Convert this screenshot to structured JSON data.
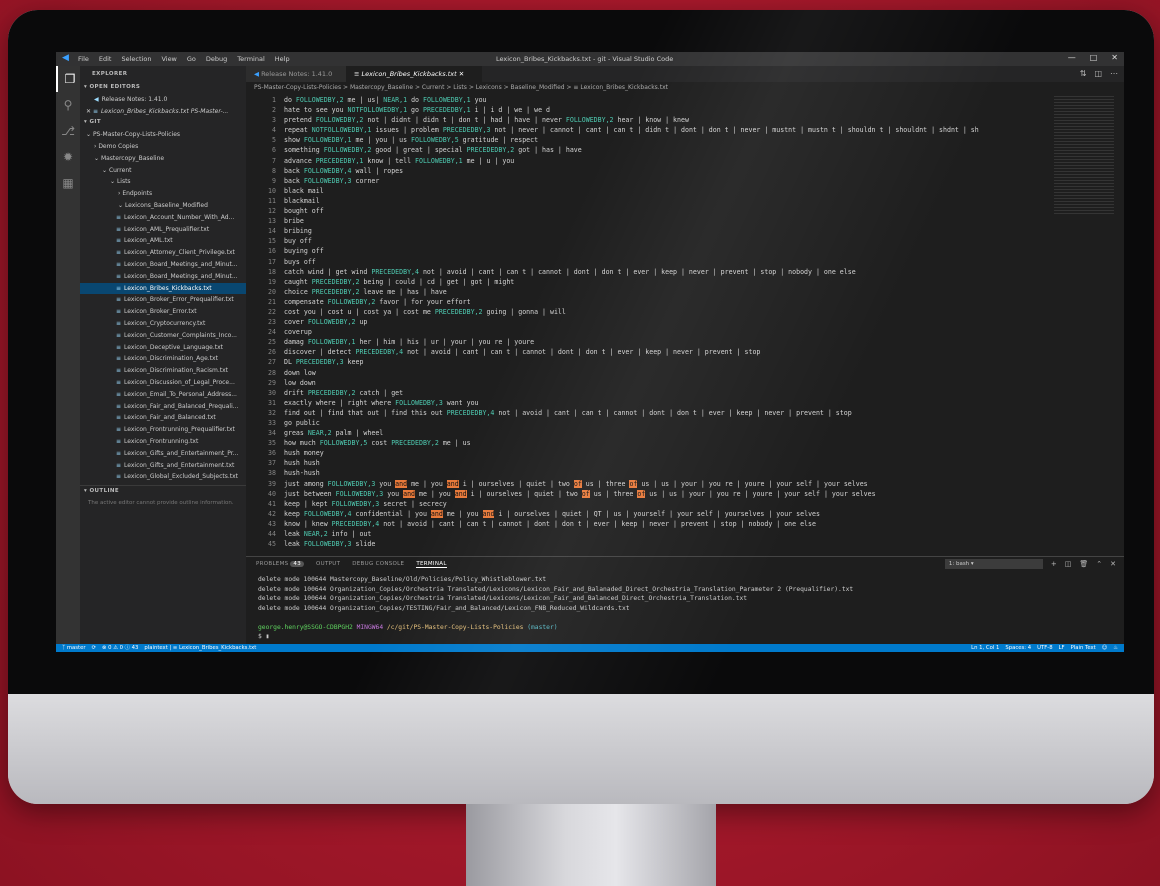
{
  "titlebar": {
    "menu": [
      "File",
      "Edit",
      "Selection",
      "View",
      "Go",
      "Debug",
      "Terminal",
      "Help"
    ],
    "title": "Lexicon_Bribes_Kickbacks.txt - git - Visual Studio Code",
    "controls": [
      "—",
      "□",
      "✕"
    ]
  },
  "sidebar": {
    "header": "EXPLORER",
    "open_editors": "OPEN EDITORS",
    "open_editor_items": [
      "Release Notes: 1.41.0",
      "Lexicon_Bribes_Kickbacks.txt PS-Master-..."
    ],
    "git_header": "GIT",
    "tree": [
      "PS-Master-Copy-Lists-Policies",
      "Demo Copies",
      "Mastercopy_Baseline",
      "Current",
      "Lists",
      "Endpoints",
      "Lexicons_Baseline_Modified"
    ],
    "files": [
      "Lexicon_Account_Number_With_Ad...",
      "Lexicon_AML_Prequalifier.txt",
      "Lexicon_AML.txt",
      "Lexicon_Attorney_Client_Privilege.txt",
      "Lexicon_Board_Meetings_and_Minut...",
      "Lexicon_Board_Meetings_and_Minut...",
      "Lexicon_Bribes_Kickbacks.txt",
      "Lexicon_Broker_Error_Prequalifier.txt",
      "Lexicon_Broker_Error.txt",
      "Lexicon_Cryptocurrency.txt",
      "Lexicon_Customer_Complaints_Inco...",
      "Lexicon_Deceptive_Language.txt",
      "Lexicon_Discrimination_Age.txt",
      "Lexicon_Discrimination_Racism.txt",
      "Lexicon_Discussion_of_Legal_Proce...",
      "Lexicon_Email_To_Personal_Address...",
      "Lexicon_Fair_and_Balanced_Prequali...",
      "Lexicon_Fair_and_Balanced.txt",
      "Lexicon_Frontrunning_Prequalifier.txt",
      "Lexicon_Frontrunning.txt",
      "Lexicon_Gifts_and_Entertainment_Pr...",
      "Lexicon_Gifts_and_Entertainment.txt",
      "Lexicon_Global_Excluded_Subjects.txt"
    ],
    "outline_header": "OUTLINE",
    "outline_note": "The active editor cannot provide outline information."
  },
  "tabs": [
    {
      "label": "Release Notes: 1.41.0"
    },
    {
      "label": "Lexicon_Bribes_Kickbacks.txt ✕"
    }
  ],
  "breadcrumb": "PS-Master-Copy-Lists-Policies > Mastercopy_Baseline > Current > Lists > Lexicons > Baseline_Modified > ≡ Lexicon_Bribes_Kickbacks.txt",
  "code": [
    "do FOLLOWEDBY,2 me | us| NEAR,1 do FOLLOWEDBY,1 you",
    "hate to see you NOTFOLLOWEDBY,1 go PRECEDEDBY,1 i | i d | we | we d",
    "pretend FOLLOWEDBY,2 not | didnt | didn t | don t | had | have | never FOLLOWEDBY,2 hear | know | knew",
    "repeat NOTFOLLOWEDBY,1 issues | problem PRECEDEDBY,3 not | never | cannot | cant | can t | didn t | dont | don t | never | mustnt | mustn t | shouldn t | shouldnt | shdnt | sh",
    "show FOLLOWEDBY,1 me | you | us FOLLOWEDBY,5 gratitude | respect",
    "something FOLLOWEDBY,2 good | great | special PRECEDEDBY,2 got | has | have",
    "advance PRECEDEDBY,1 know | tell FOLLOWEDBY,1 me | u | you",
    "back FOLLOWEDBY,4 wall | ropes",
    "back FOLLOWEDBY,3 corner",
    "black mail",
    "blackmail",
    "bought off",
    "bribe",
    "bribing",
    "buy off",
    "buying off",
    "buys off",
    "catch wind | get wind PRECEDEDBY,4 not | avoid | cant | can t | cannot | dont | don t | ever | keep | never | prevent | stop | nobody | one else",
    "caught PRECEDEDBY,2 being | could | cd | get | got | might",
    "choice PRECEDEDBY,2 leave me | has | have",
    "compensate FOLLOWEDBY,2 favor | for your effort",
    "cost you | cost u | cost ya | cost me PRECEDEDBY,2 going | gonna | will",
    "cover FOLLOWEDBY,2 up",
    "coverup",
    "damag FOLLOWEDBY,1 her | him | his | ur | your | you re | youre",
    "discover | detect PRECEDEDBY,4 not | avoid | cant | can t | cannot | dont | don t | ever | keep | never | prevent | stop",
    "DL PRECEDEDBY,3 keep",
    "down low",
    "low down",
    "drift PRECEDEDBY,2 catch | get",
    "exactly where | right where FOLLOWEDBY,3 want you",
    "find out | find that out | find this out PRECEDEDBY,4 not | avoid | cant | can t | cannot | dont | don t | ever | keep | never | prevent | stop",
    "go public",
    "greas NEAR,2 palm | wheel",
    "how much FOLLOWEDBY,5 cost PRECEDEDBY,2 me | us",
    "hush money",
    "hush hush",
    "hush-hush",
    "just among FOLLOWEDBY,3 you and me | you and i | ourselves | quiet | two of us | three of us | us | your | you re | youre | your self | your selves",
    "just between FOLLOWEDBY,3 you and me | you and i | ourselves | quiet | two of us | three of us | us | your | you re | youre | your self | your selves",
    "keep | kept FOLLOWEDBY,3 secret | secrecy",
    "keep FOLLOWEDBY,4 confidential | you and me | you and i | ourselves | quiet | QT | us | yourself | your self | yourselves | your selves",
    "know | knew PRECEDEDBY,4 not | avoid | cant | can t | cannot | dont | don t | ever | keep | never | prevent | stop | nobody | one else",
    "leak NEAR,2 info | out",
    "leak FOLLOWEDBY,3 slide"
  ],
  "panel": {
    "tabs": [
      "PROBLEMS",
      "OUTPUT",
      "DEBUG CONSOLE",
      "TERMINAL"
    ],
    "problems_count": "43",
    "shell": "1: bash",
    "terminal_lines": [
      "delete mode 100644 Mastercopy_Baseline/Old/Policies/Policy_Whistleblower.txt",
      "delete mode 100644 Organization_Copies/Orchestria Translated/Lexicons/Lexicon_Fair_and_Balanaded_Direct_Orchestria_Translation_Parameter 2 (Prequalifier).txt",
      "delete mode 100644 Organization_Copies/Orchestria Translated/Lexicons/Lexicon_Fair_and_Balanced_Direct_Orchestria_Translation.txt",
      "delete mode 100644 Organization_Copies/TESTING/Fair_and_Balanced/Lexicon_FNB_Reduced_Wildcards.txt"
    ],
    "prompt_user": "george.henry@SSGO-CDBPGH2",
    "prompt_env": "MINGW64",
    "prompt_path": "/c/git/PS-Master-Copy-Lists-Policies",
    "prompt_branch": "(master)",
    "prompt_symbol": "$"
  },
  "statusbar": {
    "branch": "master",
    "sync": "⟳",
    "problems": "⊗ 0 ⚠ 0 ⓘ 43",
    "language_left": "plaintext | ≡ Lexicon_Bribes_Kickbacks.txt",
    "position": "Ln 1, Col 1",
    "spaces": "Spaces: 4",
    "encoding": "UTF-8",
    "eol": "LF",
    "mode": "Plain Text"
  }
}
